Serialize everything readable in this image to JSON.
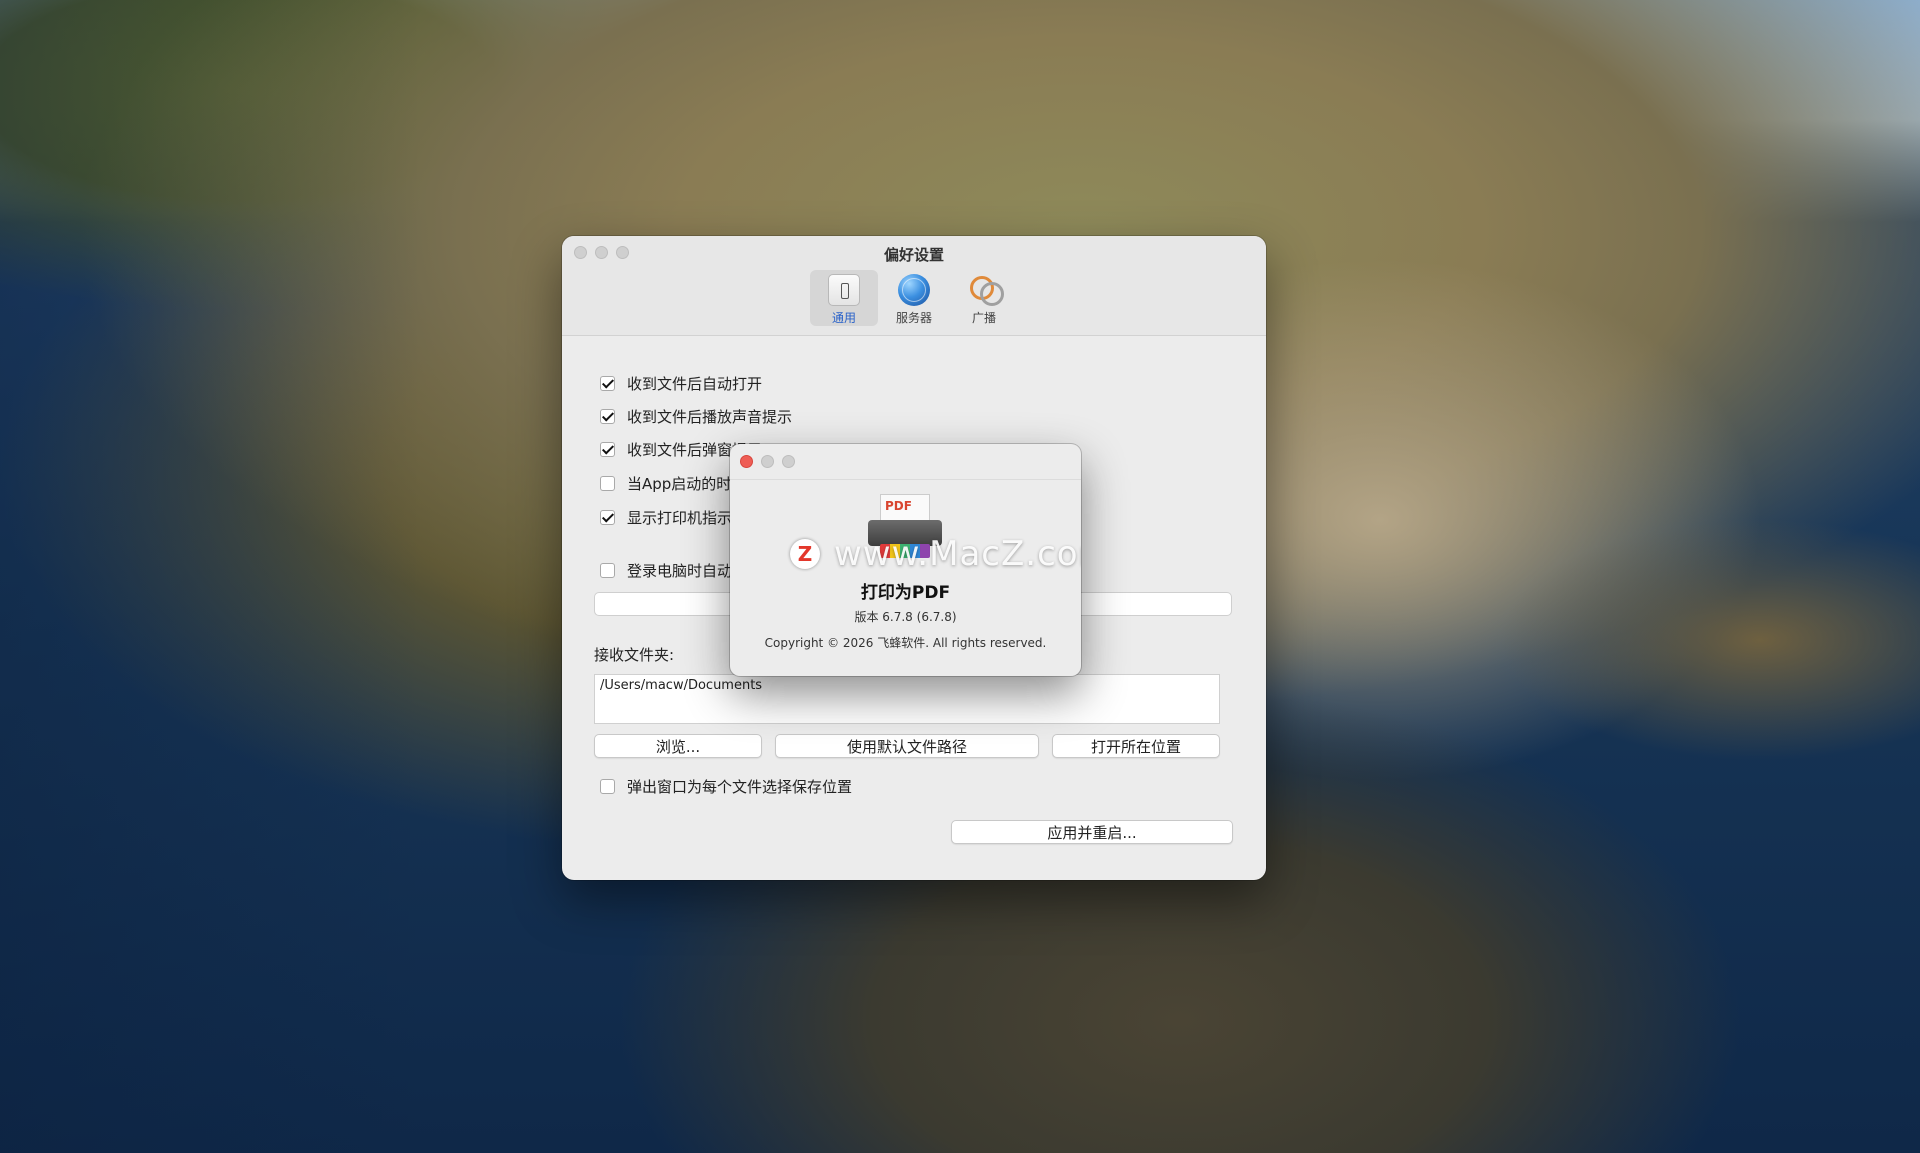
{
  "prefs": {
    "title": "偏好设置",
    "tabs": [
      {
        "label": "通用",
        "icon": "general-switch-icon",
        "active": true
      },
      {
        "label": "服务器",
        "icon": "globe-server-icon",
        "active": false
      },
      {
        "label": "广播",
        "icon": "broadcast-icon",
        "active": false
      }
    ],
    "options": [
      {
        "label": "收到文件后自动打开",
        "checked": true
      },
      {
        "label": "收到文件后播放声音提示",
        "checked": true
      },
      {
        "label": "收到文件后弹窗提示",
        "checked": true
      },
      {
        "label": "当App启动的时",
        "checked": false
      },
      {
        "label": "显示打印机指示",
        "checked": true
      }
    ],
    "login_option": {
      "label": "登录电脑时自动",
      "checked": false
    },
    "folder_label": "接收文件夹:",
    "folder_path": "/Users/macw/Documents",
    "buttons": {
      "browse": "浏览...",
      "default_path": "使用默认文件路径",
      "open_location": "打开所在位置",
      "apply_restart": "应用并重启..."
    },
    "popup_option": {
      "label": "弹出窗口为每个文件选择保存位置",
      "checked": false
    }
  },
  "about": {
    "icon_text": "PDF",
    "app_name": "打印为PDF",
    "version": "版本 6.7.8 (6.7.8)",
    "copyright": "Copyright © 2026 飞蜂软件. All rights reserved.",
    "watermark_badge": "Z",
    "watermark": "www.MacZ.com"
  }
}
